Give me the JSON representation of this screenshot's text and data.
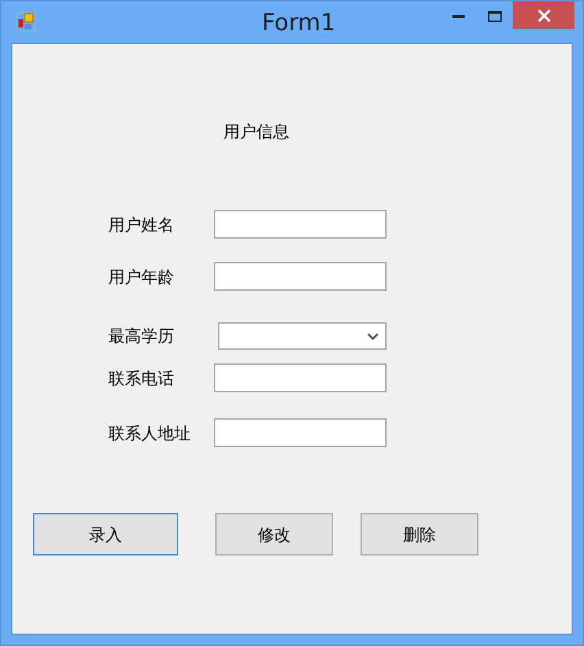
{
  "window": {
    "title": "Form1"
  },
  "heading": "用户信息",
  "fields": [
    {
      "label": "用户姓名",
      "kind": "text"
    },
    {
      "label": "用户年龄",
      "kind": "text"
    },
    {
      "label": "最高学历",
      "kind": "combo"
    },
    {
      "label": "联系电话",
      "kind": "text"
    },
    {
      "label": "联系人地址",
      "kind": "text"
    }
  ],
  "buttons": [
    {
      "label": "录入",
      "focused": true
    },
    {
      "label": "修改",
      "focused": false
    },
    {
      "label": "删除",
      "focused": false
    }
  ]
}
